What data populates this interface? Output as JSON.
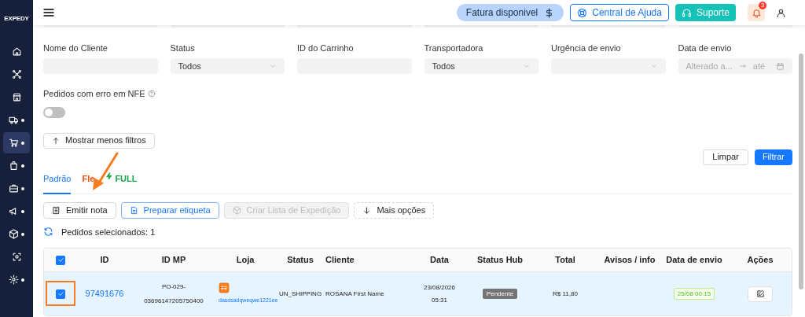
{
  "sidebar": {
    "logo": "EXPEDY",
    "items": [
      {
        "selected": false,
        "submenu": false
      },
      {
        "selected": false,
        "submenu": false
      },
      {
        "selected": false,
        "submenu": false
      },
      {
        "selected": false,
        "submenu": true
      },
      {
        "selected": true,
        "submenu": true
      },
      {
        "selected": false,
        "submenu": true
      },
      {
        "selected": false,
        "submenu": true
      },
      {
        "selected": false,
        "submenu": true
      },
      {
        "selected": false,
        "submenu": true
      },
      {
        "selected": false,
        "submenu": false
      },
      {
        "selected": false,
        "submenu": true
      }
    ]
  },
  "header": {
    "invoice": "Fatura disponivel",
    "help": "Central de Ajuda",
    "support": "Suporte",
    "notifications": "3"
  },
  "filters": [
    {
      "kind": "text",
      "label": "Nome do Cliente"
    },
    {
      "kind": "select",
      "label": "Status",
      "value": "Todos"
    },
    {
      "kind": "text",
      "label": "ID do Carrinho"
    },
    {
      "kind": "select",
      "label": "Transportadora",
      "value": "Todos"
    },
    {
      "kind": "select",
      "label": "Urgência de envio"
    },
    {
      "kind": "daterange",
      "label": "Data de envio",
      "placeholder_start": "Alterado a...",
      "placeholder_end": "até"
    }
  ],
  "nfe_filter": {
    "label": "Pedidos com erro em NFE",
    "on": false
  },
  "toggle_filters": "Mostrar menos filtros",
  "clear_button": "Limpar",
  "filter_button": "Filtrar",
  "tabs": [
    {
      "label": "Padrão",
      "selected": true,
      "color": "#1677ff"
    },
    {
      "label": "Fle",
      "selected": false,
      "color": "#ff4d00"
    },
    {
      "label": "FULL",
      "selected": false,
      "color": "#16a34a"
    }
  ],
  "actions": [
    {
      "kind": "default",
      "label": "Emitir nota",
      "disabled": false
    },
    {
      "kind": "primary",
      "label": "Preparar etiqueta",
      "disabled": false
    },
    {
      "kind": "default",
      "label": "Criar Lista de Expedição",
      "disabled": true
    },
    {
      "kind": "dashed",
      "label": "Mais opções",
      "disabled": false
    }
  ],
  "selected_count": "Pedidos selecionados: 1",
  "table": {
    "all_checked": true,
    "columns": [
      "ID",
      "ID MP",
      "Loja",
      "Status",
      "Cliente",
      "Data",
      "Status Hub",
      "Total",
      "Avisos / info",
      "Data de envio",
      "Ações"
    ],
    "rows": [
      {
        "checked": true,
        "id": "97491676",
        "id_mp_1": "PO-029-",
        "id_mp_2": "03696147205750400",
        "store": "dasdsadqweqwe1221ee",
        "status": "UN_SHIPPING",
        "client": "ROSANA First Name",
        "date": "23/08/2026",
        "time": "05:31",
        "status_hub": "Pendente",
        "total": "R$ 11,80",
        "ship_date": "25/08 00:15"
      }
    ]
  }
}
